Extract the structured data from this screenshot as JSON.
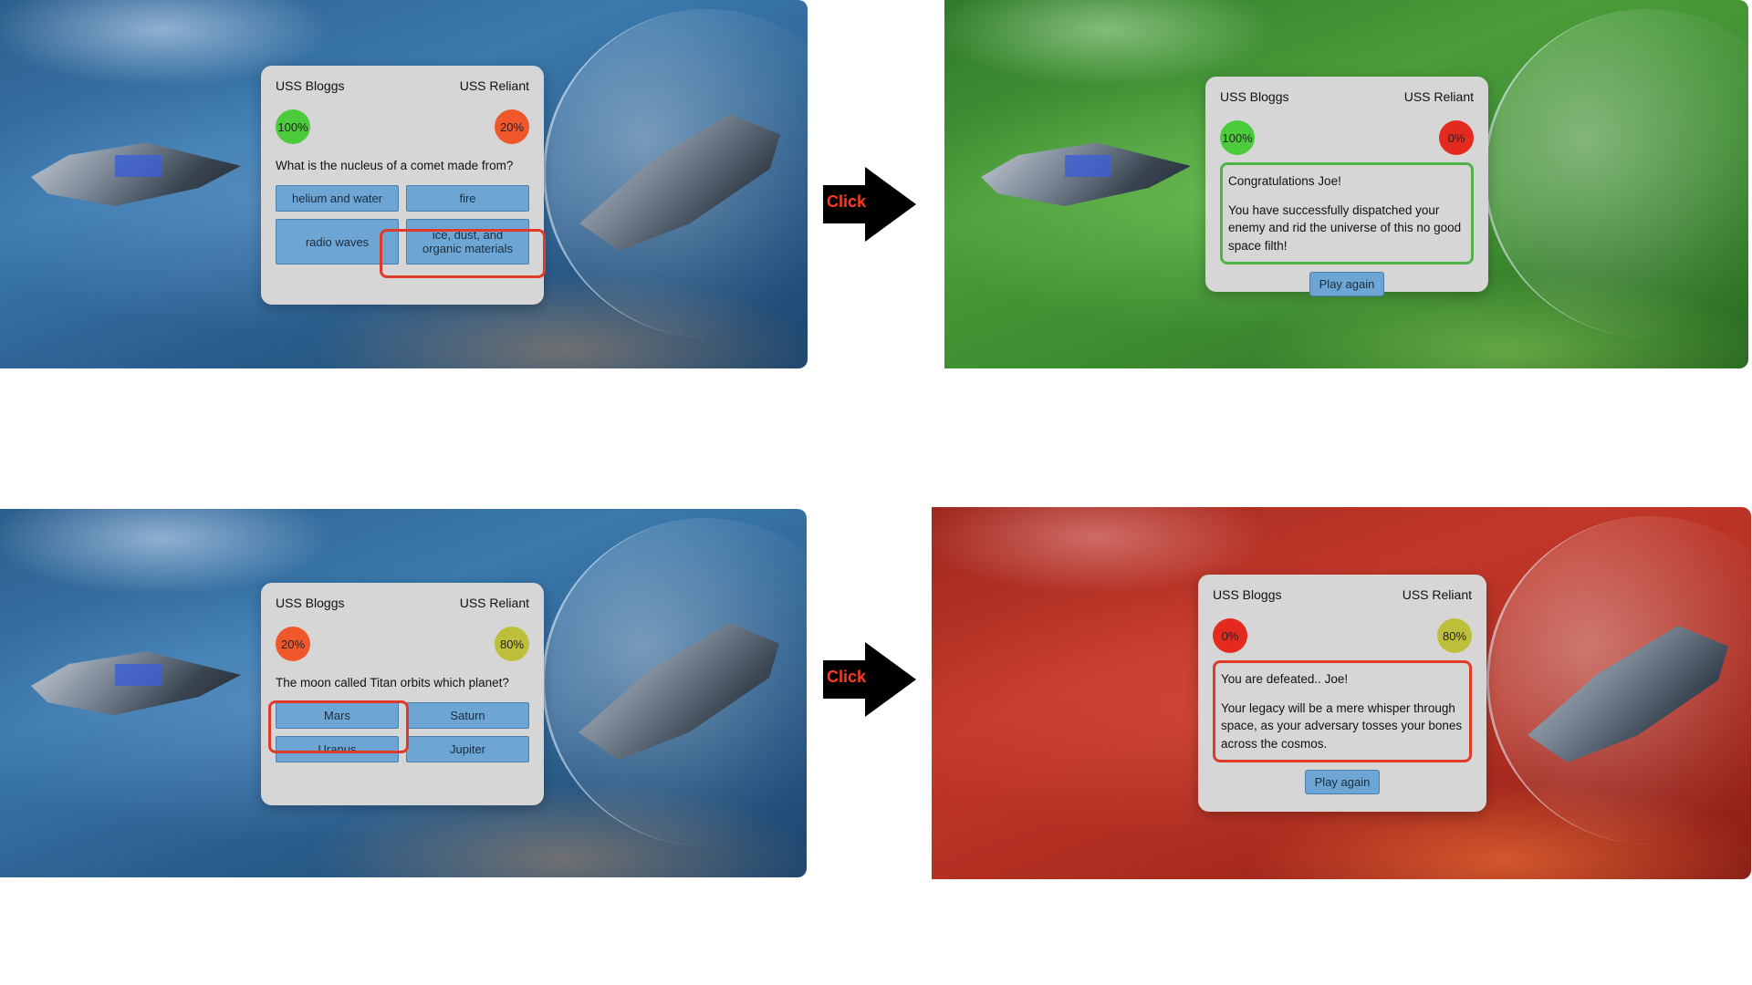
{
  "arrows": {
    "label": "Click"
  },
  "colors": {
    "answer_button": "#6da6d5",
    "panel": "#d6d6d6",
    "highlight_red": "#e03a2a",
    "win_border": "#4fb34a"
  },
  "panel1": {
    "player": "USS Bloggs",
    "enemy": "USS Reliant",
    "player_health": "100%",
    "enemy_health": "20%",
    "question": "What is the nucleus of a comet made from?",
    "answers": [
      "helium and water",
      "fire",
      "radio waves",
      "ice, dust, and organic materials"
    ],
    "selected_answer": "ice, dust, and organic materials"
  },
  "panel2": {
    "player": "USS Bloggs",
    "enemy": "USS Reliant",
    "player_health": "100%",
    "enemy_health": "0%",
    "title": "Congratulations Joe!",
    "message": "You have successfully dispatched your enemy and rid the universe of this no good space filth!",
    "play_again": "Play again"
  },
  "panel3": {
    "player": "USS Bloggs",
    "enemy": "USS Reliant",
    "player_health": "20%",
    "enemy_health": "80%",
    "question": "The moon called Titan orbits which planet?",
    "answers": [
      "Mars",
      "Saturn",
      "Uranus",
      "Jupiter"
    ],
    "selected_answer": "Mars"
  },
  "panel4": {
    "player": "USS Bloggs",
    "enemy": "USS Reliant",
    "player_health": "0%",
    "enemy_health": "80%",
    "title": "You are defeated.. Joe!",
    "message": "Your legacy will be a mere whisper through space, as your adversary tosses your bones across the cosmos.",
    "play_again": "Play again"
  }
}
